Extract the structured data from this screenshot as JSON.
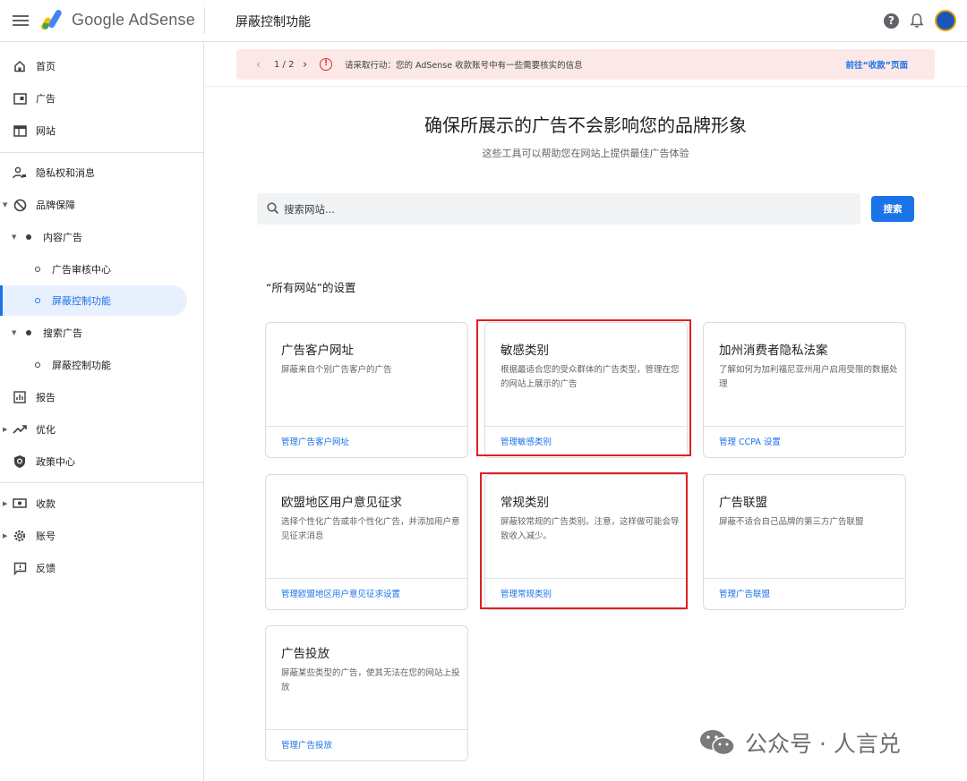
{
  "header": {
    "brand": "Google AdSense",
    "page_title": "屏蔽控制功能",
    "help_glyph": "?"
  },
  "sidebar": {
    "items": [
      {
        "label": "首页",
        "icon": "home-icon"
      },
      {
        "label": "广告",
        "icon": "ads-icon"
      },
      {
        "label": "网站",
        "icon": "sites-icon"
      },
      {
        "label": "隐私权和消息",
        "icon": "privacy-icon"
      },
      {
        "label": "品牌保障",
        "icon": "block-icon"
      },
      {
        "label": "内容广告",
        "icon": "dot-icon"
      },
      {
        "label": "广告审核中心",
        "icon": "ring-icon"
      },
      {
        "label": "屏蔽控制功能",
        "icon": "ring-icon"
      },
      {
        "label": "搜索广告",
        "icon": "dot-icon"
      },
      {
        "label": "屏蔽控制功能",
        "icon": "ring-icon"
      },
      {
        "label": "报告",
        "icon": "report-icon"
      },
      {
        "label": "优化",
        "icon": "trend-icon"
      },
      {
        "label": "政策中心",
        "icon": "policy-icon"
      },
      {
        "label": "收款",
        "icon": "payments-icon"
      },
      {
        "label": "账号",
        "icon": "gear-icon"
      },
      {
        "label": "反馈",
        "icon": "feedback-icon"
      }
    ]
  },
  "alert": {
    "pager": "1 / 2",
    "message": "请采取行动：您的 AdSense 收款账号中有一些需要核实的信息",
    "link": "前往“收款”页面",
    "warn_glyph": "!"
  },
  "hero": {
    "title": "确保所展示的广告不会影响您的品牌形象",
    "subtitle": "这些工具可以帮助您在网站上提供最佳广告体验"
  },
  "search": {
    "placeholder": "搜索网站...",
    "button": "搜索"
  },
  "section_title": "“所有网站”的设置",
  "cards": [
    {
      "title": "广告客户网址",
      "desc": "屏蔽来自个别广告客户的广告",
      "link": "管理广告客户网址"
    },
    {
      "title": "敏感类别",
      "desc": "根据最适合您的受众群体的广告类型，管理在您的网站上展示的广告",
      "link": "管理敏感类别"
    },
    {
      "title": "加州消费者隐私法案",
      "desc": "了解如何为加利福尼亚州用户启用受限的数据处理",
      "link": "管理 CCPA 设置"
    },
    {
      "title": "欧盟地区用户意见征求",
      "desc": "选择个性化广告或非个性化广告，并添加用户意见征求消息",
      "link": "管理欧盟地区用户意见征求设置"
    },
    {
      "title": "常规类别",
      "desc": "屏蔽较常规的广告类别。注意，这样做可能会导致收入减少。",
      "link": "管理常规类别"
    },
    {
      "title": "广告联盟",
      "desc": "屏蔽不适合自己品牌的第三方广告联盟",
      "link": "管理广告联盟"
    },
    {
      "title": "广告投放",
      "desc": "屏蔽某些类型的广告，使其无法在您的网站上投放",
      "link": "管理广告投放"
    }
  ],
  "watermark": {
    "text": "公众号 · 人言兑"
  },
  "colors": {
    "accent": "#1a73e8",
    "alert_bg": "#fce8e6",
    "highlight": "#e02020"
  }
}
